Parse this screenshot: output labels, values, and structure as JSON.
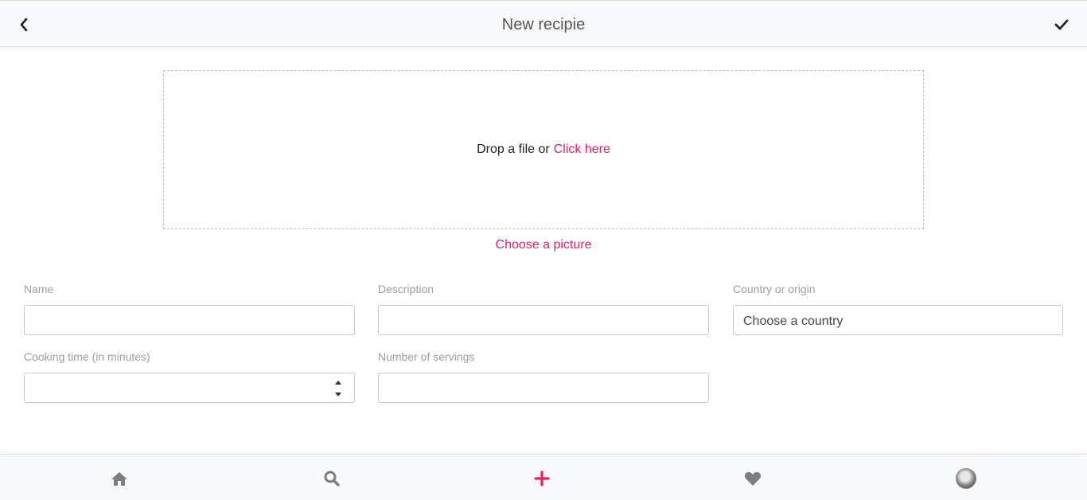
{
  "header": {
    "title": "New recipie",
    "back_icon": "chevron-left-icon",
    "confirm_icon": "checkmark-icon"
  },
  "upload": {
    "prompt": "Drop a file or",
    "link": "Click here",
    "choose_picture": "Choose a picture"
  },
  "form": {
    "name": {
      "label": "Name",
      "value": ""
    },
    "description": {
      "label": "Description",
      "value": ""
    },
    "country": {
      "label": "Country or origin",
      "placeholder": "Choose a country"
    },
    "cooking_time": {
      "label": "Cooking time (in minutes)",
      "value": ""
    },
    "servings": {
      "label": "Number of servings",
      "value": ""
    }
  },
  "bottom_nav": {
    "items": [
      "home-icon",
      "search-icon",
      "plus-icon",
      "heart-icon",
      "avatar"
    ]
  },
  "colors": {
    "accent": "#e91e63",
    "bar_background": "#f8f9fa",
    "icon_gray": "#7d7d7d"
  }
}
